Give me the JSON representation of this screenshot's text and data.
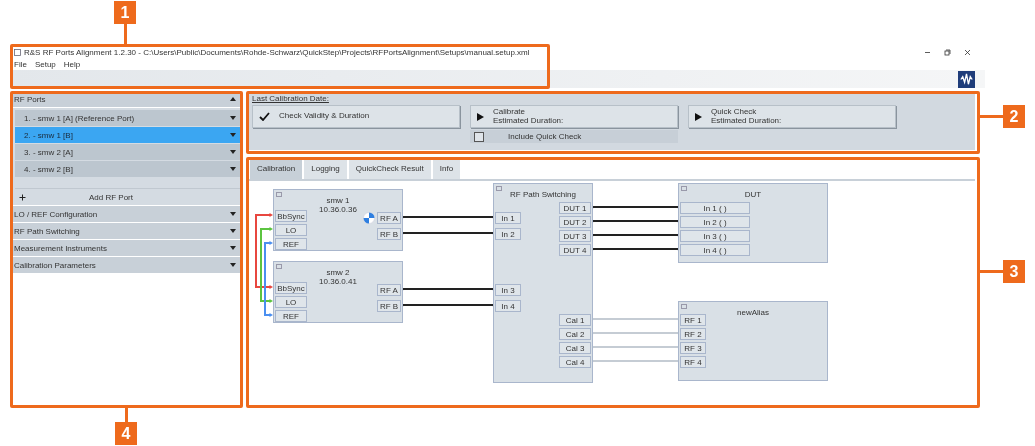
{
  "window": {
    "title": "R&S RF Ports Alignment 1.2.30 - C:\\Users\\Public\\Documents\\Rohde-Schwarz\\QuickStep\\Projects\\RFPortsAlignment\\Setups\\manual.setup.xml"
  },
  "menu": [
    "File",
    "Setup",
    "Help"
  ],
  "callouts": [
    "1",
    "2",
    "3",
    "4"
  ],
  "sidebar": {
    "sections": [
      {
        "label": "RF Ports",
        "expanded": true,
        "add_button": "Add RF Port",
        "items": [
          {
            "label": "1. - smw 1 [A] (Reference Port)",
            "selected": false,
            "expanded": false
          },
          {
            "label": "2. - smw 1 [B]",
            "selected": true,
            "expanded": false
          },
          {
            "label": "3. - smw 2 [A]",
            "selected": false,
            "expanded": false
          },
          {
            "label": "4. - smw 2 [B]",
            "selected": false,
            "expanded": false
          }
        ]
      },
      {
        "label": "LO / REF Configuration",
        "expanded": false
      },
      {
        "label": "RF Path Switching",
        "expanded": false
      },
      {
        "label": "Measurement Instruments",
        "expanded": false
      },
      {
        "label": "Calibration Parameters",
        "expanded": false
      }
    ]
  },
  "calibration": {
    "last_date_label": "Last Calibration Date:",
    "buttons": [
      {
        "kind": "check",
        "label": "Check Validity & Duration"
      },
      {
        "kind": "run",
        "label": "Calibrate",
        "sublabel": "Estimated Duration:"
      },
      {
        "kind": "run",
        "label": "Quick Check",
        "sublabel": "Estimated Duration:"
      }
    ],
    "include_quick_check": {
      "label": "Include Quick Check",
      "checked": false
    }
  },
  "tabs": [
    {
      "label": "Calibration",
      "selected": true
    },
    {
      "label": "Logging",
      "selected": false
    },
    {
      "label": "QuickCheck Result",
      "selected": false
    },
    {
      "label": "Info",
      "selected": false
    }
  ],
  "diagram": {
    "nodes": [
      {
        "title": "smw 1",
        "address": "10.36.0.36",
        "busy": true,
        "inputs": [
          "BbSync",
          "LO",
          "REF"
        ],
        "outputs": [
          "RF A",
          "RF B"
        ]
      },
      {
        "title": "smw 2",
        "address": "10.36.0.41",
        "busy": false,
        "inputs": [
          "BbSync",
          "LO",
          "REF"
        ],
        "outputs": [
          "RF A",
          "RF B"
        ]
      },
      {
        "title": "RF Path Switching",
        "busy": false,
        "inputs": [
          "In 1",
          "In 2",
          "In 3",
          "In 4"
        ],
        "outputs": [
          "DUT 1",
          "DUT 2",
          "DUT 3",
          "DUT 4",
          "Cal 1",
          "Cal 2",
          "Cal 3",
          "Cal 4"
        ]
      },
      {
        "title": "DUT",
        "busy": false,
        "inputs": [
          "In 1 ( )",
          "In 2 ( )",
          "In 3 ( )",
          "In 4 ( )"
        ]
      },
      {
        "title": "newAlias",
        "busy": false,
        "inputs": [
          "RF 1",
          "RF 2",
          "RF 3",
          "RF 4"
        ]
      }
    ],
    "wires": [
      {
        "kind": "link",
        "color": "#222222"
      },
      {
        "kind": "link",
        "color": "#222222"
      },
      {
        "kind": "link",
        "color": "#222222"
      },
      {
        "kind": "link",
        "color": "#222222"
      },
      {
        "kind": "link",
        "color": "#222222"
      },
      {
        "kind": "link",
        "color": "#222222"
      },
      {
        "kind": "link",
        "color": "#222222"
      },
      {
        "kind": "link",
        "color": "#222222"
      },
      {
        "kind": "link",
        "color": "#c5ccd4"
      },
      {
        "kind": "link",
        "color": "#c5ccd4"
      },
      {
        "kind": "link",
        "color": "#c5ccd4"
      },
      {
        "kind": "link",
        "color": "#c5ccd4"
      },
      {
        "kind": "sync",
        "color": "#e8473f"
      },
      {
        "kind": "sync",
        "color": "#5cc440"
      },
      {
        "kind": "sync",
        "color": "#4a8ff0"
      }
    ]
  }
}
